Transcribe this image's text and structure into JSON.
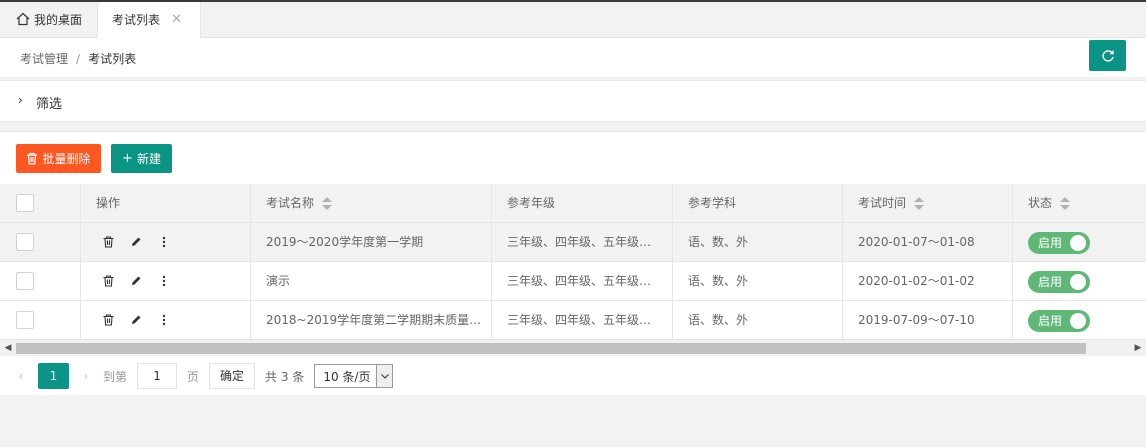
{
  "tabs": {
    "home_label": "我的桌面",
    "exam_label": "考试列表",
    "close_glyph": "✕"
  },
  "breadcrumb": {
    "parent": "考试管理",
    "separator": "/",
    "current": "考试列表"
  },
  "filter": {
    "label": "筛选",
    "chevron": "›"
  },
  "toolbar": {
    "batch_delete_label": "批量删除",
    "new_label": "新建",
    "new_glyph": "+"
  },
  "table": {
    "headers": {
      "ops": "操作",
      "name": "考试名称",
      "grade": "参考年级",
      "subject": "参考学科",
      "time": "考试时间",
      "status": "状态"
    },
    "rows": [
      {
        "name": "2019～2020学年度第一学期",
        "grade": "三年级、四年级、五年级…",
        "subject": "语、数、外",
        "time": "2020-01-07～01-08",
        "status": "启用"
      },
      {
        "name": "演示",
        "grade": "三年级、四年级、五年级…",
        "subject": "语、数、外",
        "time": "2020-01-02～01-02",
        "status": "启用"
      },
      {
        "name": "2018~2019学年度第二学期期末质量…",
        "grade": "三年级、四年级、五年级…",
        "subject": "语、数、外",
        "time": "2019-07-09～07-10",
        "status": "启用"
      }
    ]
  },
  "scrollbar": {
    "left_arrow": "◀",
    "right_arrow": "▶"
  },
  "pager": {
    "prev": "‹",
    "current_page": "1",
    "next": "›",
    "goto_label": "到第",
    "goto_value": "1",
    "page_unit": "页",
    "confirm": "确定",
    "total": "共 3 条",
    "page_size": "10 条/页"
  },
  "colors": {
    "accent": "#0a9486",
    "danger": "#ff5722",
    "switch_on": "#5fb878"
  }
}
